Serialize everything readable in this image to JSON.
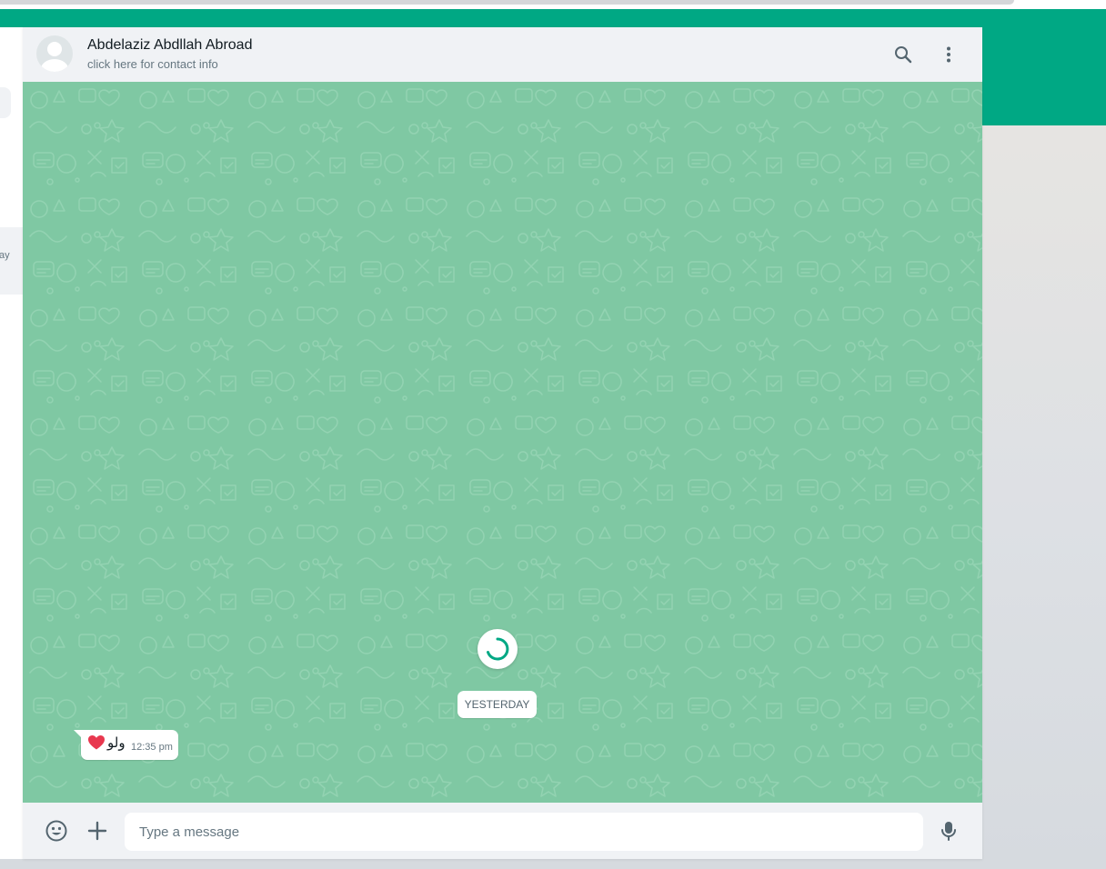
{
  "colors": {
    "accent": "#00a884",
    "wallpaper": "#7fc8a3",
    "header_bg": "#f0f2f5",
    "text_primary": "#111b21",
    "text_secondary": "#667781",
    "icon": "#54656f",
    "heart": "#e8384f"
  },
  "sidebar": {
    "chat_preview_time": "ay"
  },
  "chat_header": {
    "contact_name": "Abdelaziz Abdllah Abroad",
    "subtitle": "click here for contact info",
    "icons": [
      "avatar-icon",
      "search-icon",
      "menu-icon"
    ]
  },
  "conversation": {
    "date_divider": "YESTERDAY",
    "loading": true,
    "messages": [
      {
        "direction": "incoming",
        "text": "ولو",
        "emoji": "red-heart",
        "time": "12:35 pm"
      }
    ]
  },
  "composer": {
    "placeholder": "Type a message",
    "icons": [
      "emoji-icon",
      "attach-plus-icon",
      "microphone-icon"
    ]
  }
}
